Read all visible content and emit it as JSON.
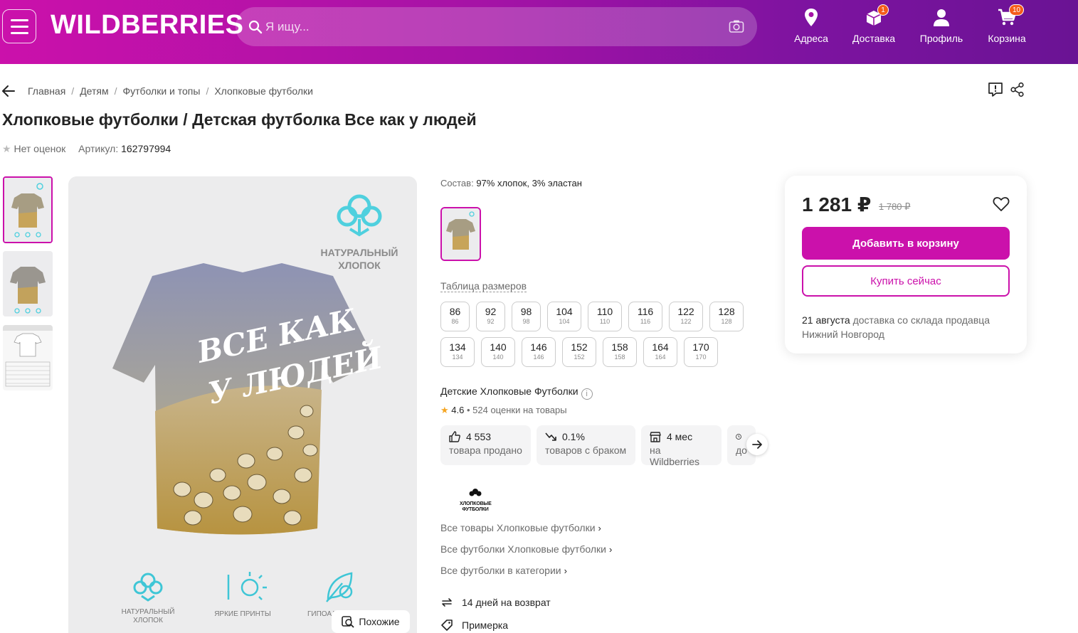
{
  "header": {
    "logo": "WILDBERRIES",
    "search_placeholder": "Я ищу...",
    "nav": [
      {
        "label": "Адреса",
        "icon": "location-pin-icon"
      },
      {
        "label": "Доставка",
        "icon": "box-icon",
        "badge": "1"
      },
      {
        "label": "Профиль",
        "icon": "user-icon"
      },
      {
        "label": "Корзина",
        "icon": "cart-icon",
        "badge": "10"
      }
    ]
  },
  "breadcrumbs": [
    "Главная",
    "Детям",
    "Футболки и топы",
    "Хлопковые футболки"
  ],
  "product": {
    "title": "Хлопковые футболки / Детская футболка Все как у людей",
    "rating_text": "Нет оценок",
    "article_label": "Артикул:",
    "article": "162797994",
    "image_badge": "НАТУРАЛЬНЫЙ ХЛОПОК",
    "image_print": "ВСЕ КАК У ЛЮДЕЙ",
    "image_features": [
      "НАТУРАЛЬНЫЙ ХЛОПОК",
      "ЯРКИЕ ПРИНТЫ",
      "ГИПОАЛ"
    ],
    "similar_label": "Похожие",
    "composition_label": "Состав:",
    "composition": "97% хлопок, 3% эластан",
    "size_table_label": "Таблица размеров",
    "sizes": [
      {
        "main": "86",
        "sub": "86"
      },
      {
        "main": "92",
        "sub": "92"
      },
      {
        "main": "98",
        "sub": "98"
      },
      {
        "main": "104",
        "sub": "104"
      },
      {
        "main": "110",
        "sub": "110"
      },
      {
        "main": "116",
        "sub": "116"
      },
      {
        "main": "122",
        "sub": "122"
      },
      {
        "main": "128",
        "sub": "128"
      },
      {
        "main": "134",
        "sub": "134"
      },
      {
        "main": "140",
        "sub": "140"
      },
      {
        "main": "146",
        "sub": "146"
      },
      {
        "main": "152",
        "sub": "152"
      },
      {
        "main": "158",
        "sub": "158"
      },
      {
        "main": "164",
        "sub": "164"
      },
      {
        "main": "170",
        "sub": "170"
      }
    ]
  },
  "seller": {
    "name": "Детские Хлопковые Футболки",
    "info_glyph": "i",
    "rating": "4.6",
    "rating_text": "• 524 оценки на товары",
    "stats": [
      {
        "value": "4 553",
        "label": "товара продано",
        "icon": "thumbs-up-icon"
      },
      {
        "value": "0.1%",
        "label": "товаров с браком",
        "icon": "trend-down-icon"
      },
      {
        "value": "4 мес",
        "label": "на Wildberries",
        "icon": "store-icon"
      },
      {
        "value": "",
        "label": "до",
        "icon": "clock-icon"
      }
    ],
    "logo_text_1": "ХЛОПКОВЫЕ",
    "logo_text_2": "ФУТБОЛКИ",
    "links": [
      "Все товары Хлопковые футболки",
      "Все футболки Хлопковые футболки",
      "Все футболки в категории"
    ],
    "features": [
      {
        "label": "14 дней на возврат",
        "icon": "return-icon"
      },
      {
        "label": "Примерка",
        "icon": "tag-icon"
      }
    ]
  },
  "price_card": {
    "price": "1 281 ₽",
    "old_price": "1 780 ₽",
    "add_to_cart": "Добавить в корзину",
    "buy_now": "Купить сейчас",
    "delivery_date": "21 августа",
    "delivery_text": "доставка со склада продавца",
    "delivery_city": "Нижний Новгород"
  },
  "colors": {
    "accent": "#cb11ab",
    "header_start": "#cb11ab",
    "header_end": "#6a1394"
  }
}
